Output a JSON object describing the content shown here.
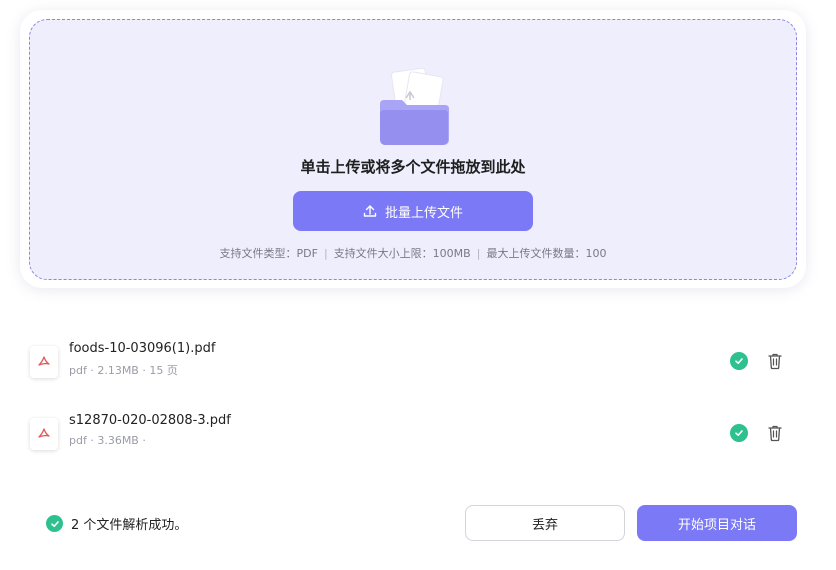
{
  "colors": {
    "accent": "#7b79f6",
    "dropzone_bg": "#efeefd",
    "dropzone_border": "#8a86e6",
    "success": "#2ec08f",
    "pdf_red": "#e25a5a"
  },
  "upload": {
    "title": "单击上传或将多个文件拖放到此处",
    "button_label": "批量上传文件",
    "button_icon": "upload-icon",
    "illustration_icon": "folder-with-documents-icon",
    "support": {
      "types": "支持文件类型：PDF",
      "size": "支持文件大小上限：100MB",
      "count": "最大上传文件数量：100",
      "separator": "|"
    }
  },
  "files": [
    {
      "name": "foods-10-03096(1).pdf",
      "meta": "pdf · 2.13MB · 15 页",
      "status_icon": "check-circle-icon",
      "action_icon": "trash-icon"
    },
    {
      "name": "s12870-020-02808-3.pdf",
      "meta": "pdf · 3.36MB ·",
      "status_icon": "check-circle-icon",
      "action_icon": "trash-icon"
    }
  ],
  "footer": {
    "status_text": "2 个文件解析成功。",
    "discard_label": "丢弃",
    "start_label": "开始项目对话"
  }
}
